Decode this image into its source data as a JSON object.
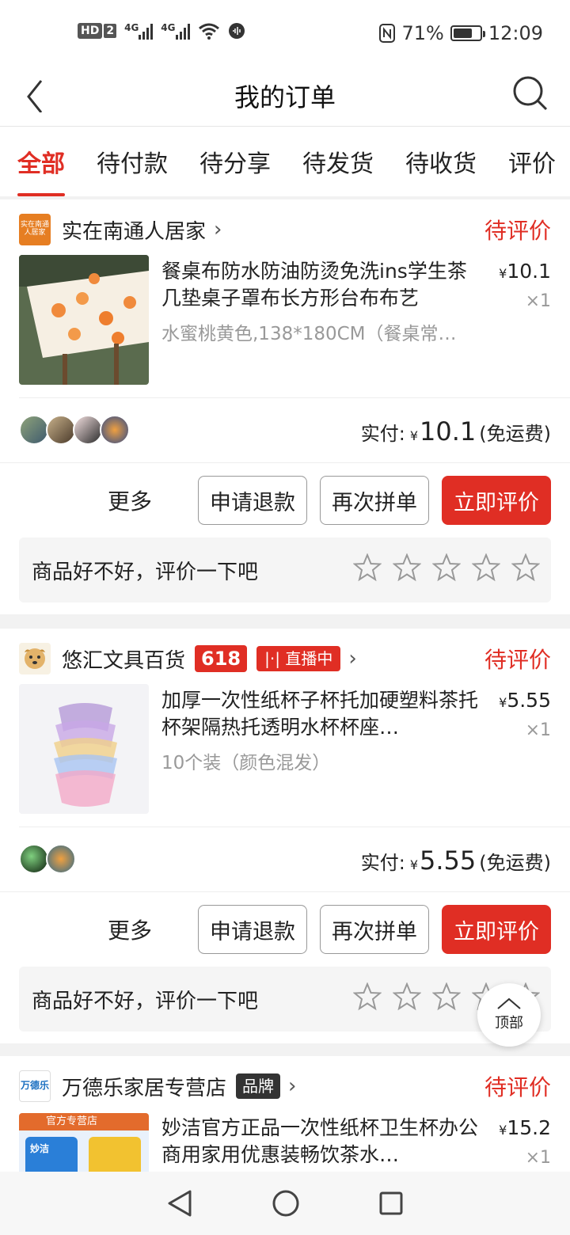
{
  "status_bar": {
    "hd_label": "HD",
    "sim_label": "2",
    "net1": "4G",
    "net2": "4G",
    "battery_percent": "71%",
    "battery_level": 0.71,
    "time": "12:09"
  },
  "header": {
    "title": "我的订单",
    "back_icon": "back-arrow-icon",
    "search_icon": "search-icon"
  },
  "tabs": [
    {
      "label": "全部",
      "active": true
    },
    {
      "label": "待付款"
    },
    {
      "label": "待分享"
    },
    {
      "label": "待发货"
    },
    {
      "label": "待收货"
    },
    {
      "label": "评价"
    }
  ],
  "orders": [
    {
      "store_name": "实在南通人居家",
      "store_logo_text": "实在南通人居家",
      "status": "待评价",
      "product_title": "餐桌布防水防油防烫免洗ins学生茶几垫桌子罩布长方形台布布艺",
      "spec": "水蜜桃黄色,138*180CM（餐桌常…",
      "price_symbol": "¥",
      "price": "10.1",
      "qty": "×1",
      "paid_label": "实付:",
      "paid_symbol": "¥",
      "paid_amount": "10.1",
      "shipping": "(免运费)",
      "more": "更多",
      "btn_refund": "申请退款",
      "btn_regroup": "再次拼单",
      "btn_review": "立即评价",
      "review_prompt": "商品好不好，评价一下吧",
      "stars": 5
    },
    {
      "store_name": "悠汇文具百货",
      "badge_618": "618",
      "badge_live": "直播中",
      "status": "待评价",
      "product_title": "加厚一次性纸杯子杯托加硬塑料茶托杯架隔热托透明水杯杯座…",
      "spec": "10个装（颜色混发）",
      "price_symbol": "¥",
      "price": "5.55",
      "qty": "×1",
      "paid_label": "实付:",
      "paid_symbol": "¥",
      "paid_amount": "5.55",
      "shipping": "(免运费)",
      "more": "更多",
      "btn_refund": "申请退款",
      "btn_regroup": "再次拼单",
      "btn_review": "立即评价",
      "review_prompt": "商品好不好，评价一下吧",
      "stars": 5
    },
    {
      "store_name": "万德乐家居专营店",
      "store_logo_text": "万德乐",
      "badge_brand": "品牌",
      "status": "待评价",
      "product_title": "妙洁官方正品一次性纸杯卫生杯办公商用家用优惠装畅饮茶水…",
      "price_symbol": "¥",
      "price": "15.2",
      "qty": "×1",
      "img_banner": "官方专营店",
      "img_brand": "妙洁"
    }
  ],
  "top_button": {
    "label": "顶部"
  },
  "colors": {
    "accent": "#e02e24"
  }
}
